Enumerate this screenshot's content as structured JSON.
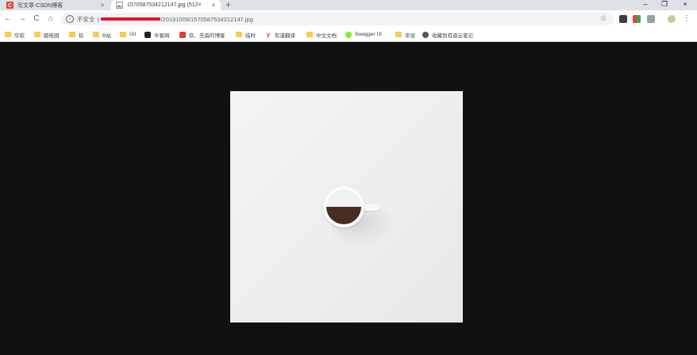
{
  "tabs": [
    {
      "title": "写文章-CSDN博客",
      "favicon": "csdn-logo-icon",
      "active": false
    },
    {
      "title": "1570587534212147.jpg (512×",
      "favicon": "image-file-icon",
      "active": true
    }
  ],
  "tab_controls": {
    "new_tab": "+",
    "close": "×"
  },
  "window_controls": {
    "minimize": "–",
    "restore": "❐",
    "close": "×"
  },
  "toolbar": {
    "back": "←",
    "forward": "→",
    "reload": "C",
    "home": "⌂",
    "security_label": "不安全",
    "url_separator": "|",
    "url_path": "/20191009/1570587534212147.jpg",
    "bookmark_star": "☆"
  },
  "bookmarks": [
    {
      "label": "华软",
      "icon": "folder-icon"
    },
    {
      "label": "碧桂园",
      "icon": "folder-icon"
    },
    {
      "label": "玖",
      "icon": "folder-icon"
    },
    {
      "label": "B站",
      "icon": "folder-icon"
    },
    {
      "label": "Git",
      "icon": "folder-icon"
    },
    {
      "label": "牛客网",
      "icon": "nowcoder-icon"
    },
    {
      "label": "玖、先森的博客",
      "icon": "csdn-logo-icon"
    },
    {
      "label": "临时",
      "icon": "folder-icon"
    },
    {
      "label": "有道翻译",
      "icon": "youdao-icon"
    },
    {
      "label": "中文文档",
      "icon": "folder-icon"
    },
    {
      "label": "Swagger UI",
      "icon": "swagger-icon"
    },
    {
      "label": "毕设",
      "icon": "folder-icon"
    },
    {
      "label": "收藏到有道云笔记",
      "icon": "globe-icon"
    }
  ],
  "colors": {
    "viewer_background": "#111111",
    "csdn_red": "#e33e33",
    "folder_yellow": "#f7cb4d",
    "redaction_red": "#e8132b"
  }
}
